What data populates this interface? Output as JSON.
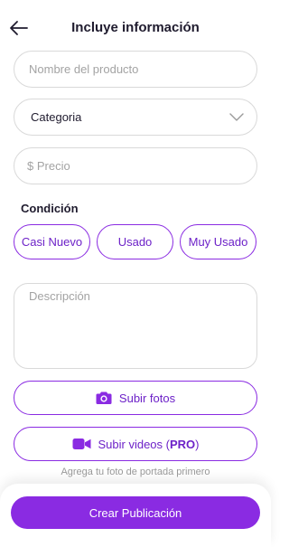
{
  "header": {
    "title": "Incluye información",
    "back_icon": "arrow-left-icon"
  },
  "form": {
    "product_name_placeholder": "Nombre del producto",
    "category_value": "Categoria",
    "category_icon": "chevron-down-icon",
    "price_placeholder": "$ Precio",
    "condition_label": "Condición",
    "condition_options": [
      "Casi Nuevo",
      "Usado",
      "Muy Usado"
    ],
    "description_placeholder": "Descripción"
  },
  "actions": {
    "upload_photos_label": "Subir fotos",
    "upload_photos_icon": "camera-icon",
    "upload_videos_label": "Subir videos (",
    "upload_videos_pro": "PRO",
    "upload_videos_suffix": ")",
    "upload_videos_icon": "video-camera-icon",
    "hint": "Agrega tu foto de portada primero"
  },
  "footer": {
    "create_label": "Crear Publicación"
  },
  "colors": {
    "accent": "#8a2be2",
    "accent_text": "#6d22c8",
    "border": "#d9d9d9",
    "placeholder": "#a3a3a3"
  }
}
